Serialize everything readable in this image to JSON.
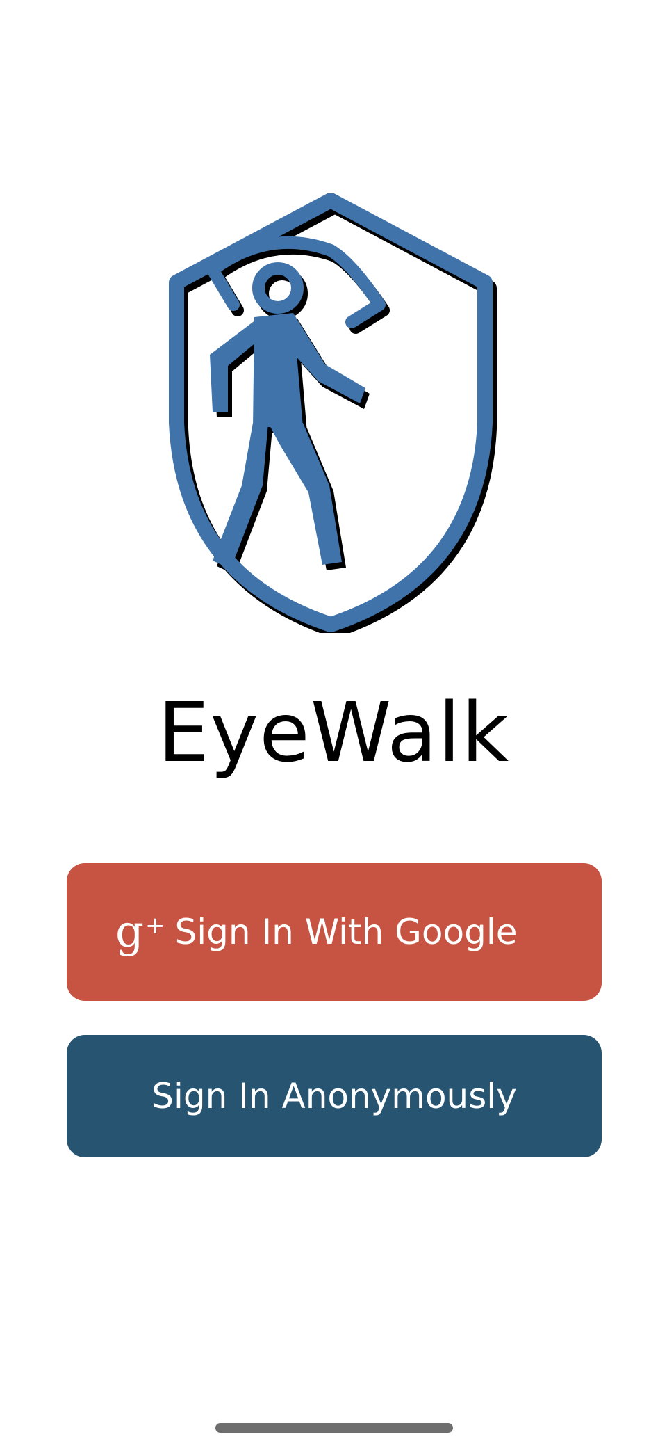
{
  "app": {
    "title": "EyeWalk"
  },
  "logo": {
    "icon": "shield-walking-person-eye-icon",
    "color": "#3F73AA",
    "shadow_color": "#000000"
  },
  "buttons": {
    "google": {
      "icon": "google-plus-icon",
      "icon_glyph": "g",
      "icon_plus": "+",
      "label": "Sign In With Google",
      "color": "#C75342"
    },
    "anonymous": {
      "label": "Sign In Anonymously",
      "color": "#275470"
    }
  },
  "system": {
    "home_indicator_color": "#6E6E6E"
  }
}
